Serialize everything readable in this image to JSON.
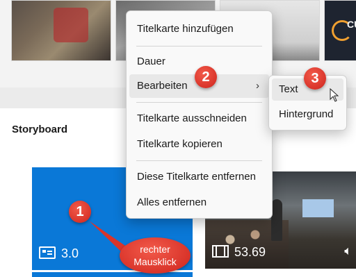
{
  "context_menu": {
    "items": [
      {
        "label": "Titelkarte hinzufügen"
      },
      {
        "label": "Dauer"
      },
      {
        "label": "Bearbeiten",
        "has_submenu": true,
        "highlighted": true
      },
      {
        "label": "Titelkarte ausschneiden"
      },
      {
        "label": "Titelkarte kopieren"
      },
      {
        "label": "Diese Titelkarte entfernen"
      },
      {
        "label": "Alles entfernen"
      }
    ],
    "submenu_chevron": "›"
  },
  "submenu": {
    "items": [
      {
        "label": "Text",
        "highlighted": true
      },
      {
        "label": "Hintergrund"
      }
    ]
  },
  "storyboard": {
    "title": "Storyboard",
    "cards": [
      {
        "kind": "title-card",
        "icon": "title-card-icon",
        "duration": "3.0",
        "color": "#0a78d7"
      },
      {
        "kind": "video",
        "icon": "film-icon",
        "duration": "53.69",
        "volume_icon": "volume-icon"
      }
    ]
  },
  "top_thumbnails": {
    "last_logo_text": "CU"
  },
  "annotations": {
    "badge_1": "1",
    "badge_2": "2",
    "badge_3": "3",
    "callout_line1": "rechter",
    "callout_line2": "Mausklick",
    "accent_color": "#d9342a"
  }
}
